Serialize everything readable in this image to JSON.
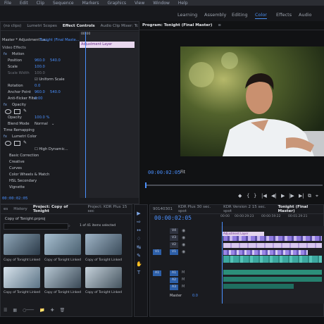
{
  "menubar": {
    "items": [
      "File",
      "Edit",
      "Clip",
      "Sequence",
      "Markers",
      "Graphics",
      "View",
      "Window",
      "Help"
    ]
  },
  "workspaces": [
    "Learning",
    "Assembly",
    "Editing",
    "Color",
    "Effects",
    "Audio"
  ],
  "workspace_active": "Color",
  "left_panel": {
    "tabs": [
      "(no clips)",
      "Lumetri Scopes",
      "Effect Controls",
      "Audio Clip Mixer: Tc"
    ],
    "active_tab": "Effect Controls",
    "source_label": "Master * Adjustment La...",
    "sequence_label": "Tonight (Final Maste...",
    "clip_label": "Adjustment Layer",
    "section_video": "Video Effects",
    "motion": "Motion",
    "position_label": "Position",
    "position_values": [
      "960.0",
      "540.0"
    ],
    "scale_label": "Scale",
    "scale_value": "100.0",
    "scale_width_label": "Scale Width",
    "scale_width_value": "100.0",
    "uniform_scale": "Uniform Scale",
    "rotation_label": "Rotation",
    "rotation_value": "0.0",
    "anchor_label": "Anchor Point",
    "anchor_values": [
      "960.0",
      "540.0"
    ],
    "antiflicker_label": "Anti-flicker Filter",
    "antiflicker_value": "0.00",
    "opacity_section": "Opacity",
    "opacity_label": "Opacity",
    "opacity_value": "100.0 %",
    "blend_label": "Blend Mode",
    "blend_value": "Normal",
    "time_remap": "Time Remapping",
    "lumetri": "Lumetri Color",
    "fx": "fx",
    "high_dynamic": "High Dynamic...",
    "basic": "Basic Correction",
    "creative": "Creative",
    "curves": "Curves",
    "wheels": "Color Wheels & Match",
    "hsl": "HSL Secondary",
    "vignette": "Vignette",
    "timecode_start": "00:00",
    "timecode_bottom": "00:00:02:05"
  },
  "program": {
    "title": "Program: Tonight (Final Master)",
    "menu_icon": "≡",
    "timecode": "00:00:02:05",
    "fit": "Fit",
    "controls": [
      "◆",
      "{",
      "}",
      "|◀",
      "◀|",
      "▶",
      "|▶",
      "▶|",
      "⧉",
      "⌖",
      "☰"
    ]
  },
  "project": {
    "tabs": [
      "es",
      "History",
      "Project: Copy of Tonight",
      "Project: KDR Plus 15 sec"
    ],
    "active_tab": "Project: Copy of Tonight",
    "file": "Copy of Tonight.prproj",
    "selection": "1 of 41 items selected",
    "items": [
      "Copy of Tonight Linked",
      "Copy of Tonight Linked",
      "Copy of Tonight Linked",
      "Copy of Tonight Linked",
      "Copy of Tonight Linked",
      "Copy of Tonight Linked"
    ]
  },
  "timeline": {
    "tabs": [
      "90140301",
      "KDR Plus 30 sec. spot",
      "KDR Version 2 15 sec. spot",
      "Tonight (Final Master)"
    ],
    "active_tab": "Tonight (Final Master)",
    "timecode": "00:00:02:05",
    "ruler": [
      "00:00",
      "00:00:29:23",
      "00:00:59:22",
      "00:01:29:21"
    ],
    "video_tracks": [
      "V4",
      "V3",
      "V2",
      "V1"
    ],
    "audio_tracks": [
      "A1",
      "A2",
      "A3"
    ],
    "source_v": "V1",
    "source_a": "A1",
    "master": "Master",
    "master_value": "0.0",
    "adjustment_label": "Adjustment Layer"
  },
  "colors": {
    "accent": "#4a90ff",
    "adjustment_clip": "#e9d8ef",
    "playhead": "#4a90ff"
  }
}
